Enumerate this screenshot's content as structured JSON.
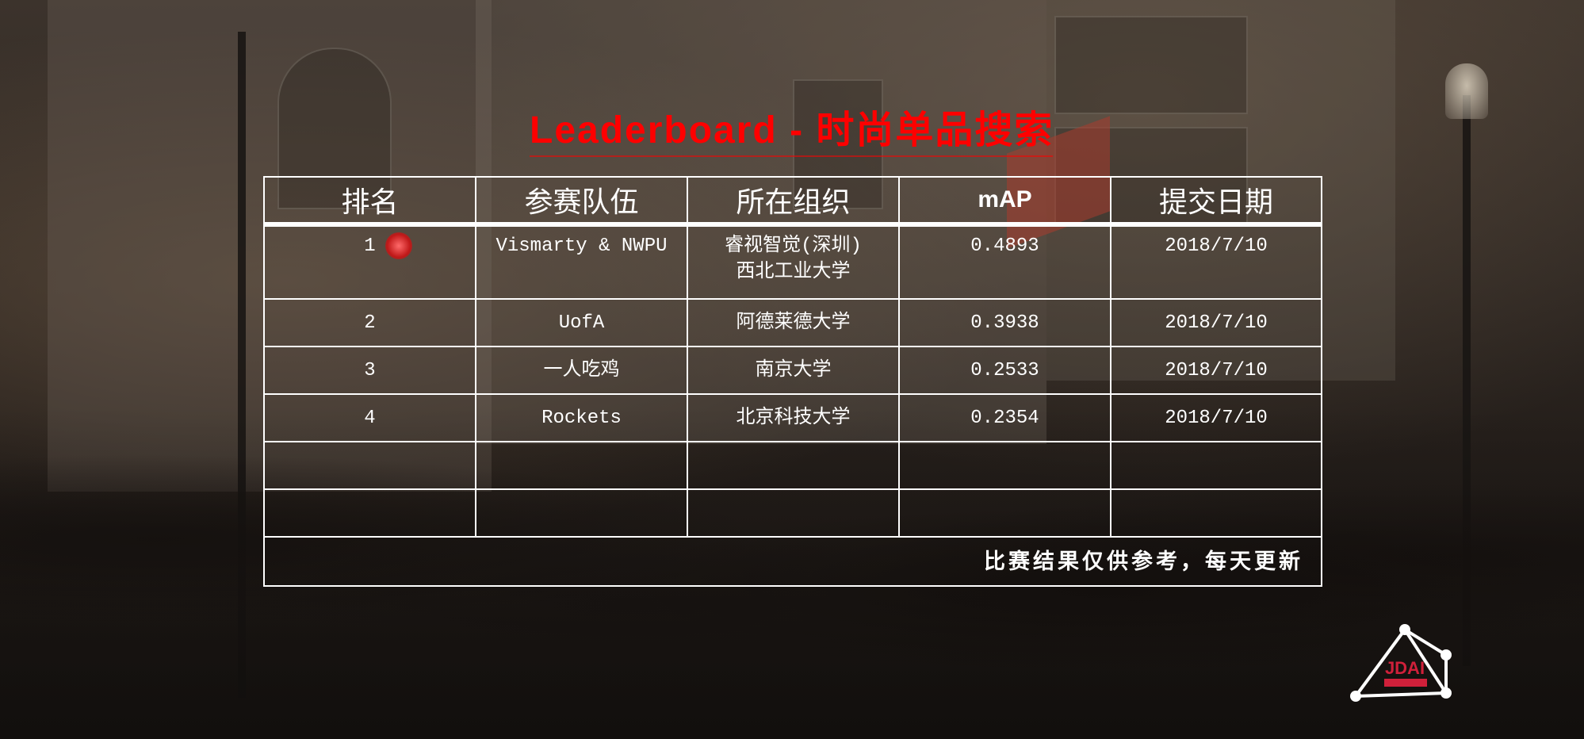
{
  "title": "Leaderboard - 时尚单品搜索",
  "table": {
    "headers": [
      "排名",
      "参赛队伍",
      "所在组织",
      "mAP",
      "提交日期"
    ],
    "rows": [
      {
        "rank": "1",
        "team": "Vismarty & NWPU",
        "org_lines": [
          "睿视智觉(深圳)",
          "西北工业大学"
        ],
        "map": "0.4893",
        "date": "2018/7/10"
      },
      {
        "rank": "2",
        "team": "UofA",
        "org_lines": [
          "阿德莱德大学"
        ],
        "map": "0.3938",
        "date": "2018/7/10"
      },
      {
        "rank": "3",
        "team": "一人吃鸡",
        "org_lines": [
          "南京大学"
        ],
        "map": "0.2533",
        "date": "2018/7/10"
      },
      {
        "rank": "4",
        "team": "Rockets",
        "org_lines": [
          "北京科技大学"
        ],
        "map": "0.2354",
        "date": "2018/7/10"
      }
    ],
    "footer_note": "比赛结果仅供参考，每天更新"
  },
  "logo_text": "JDAI",
  "colors": {
    "title": "#ff0000",
    "table_text": "#ffffff",
    "table_border": "#ffffff",
    "logo_accent": "#d0203a"
  },
  "icons": [
    "jdai-logo-icon"
  ]
}
